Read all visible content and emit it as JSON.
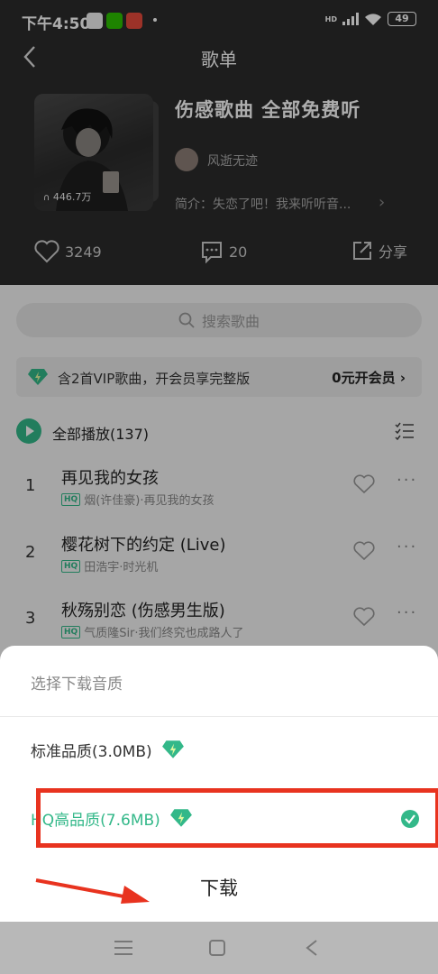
{
  "status_bar": {
    "time": "下午4:50",
    "network_label": "HD",
    "battery": "49"
  },
  "nav": {
    "title": "歌单"
  },
  "playlist": {
    "title": "伤感歌曲  全部免费听",
    "play_count": "446.7万",
    "creator": "风逝无迹",
    "intro": "简介：失恋了吧！我来听听音..."
  },
  "actions": {
    "likes": "3249",
    "comments": "20",
    "share_label": "分享"
  },
  "search": {
    "placeholder": "搜索歌曲"
  },
  "vip_banner": {
    "text": "含2首VIP歌曲，开会员享完整版",
    "cta": "0元开会员"
  },
  "play_all": {
    "label": "全部播放(137)"
  },
  "songs": [
    {
      "index": "1",
      "title": "再见我的女孩",
      "badge": "HQ",
      "meta": "烟(许佳豪)·再见我的女孩"
    },
    {
      "index": "2",
      "title": "樱花树下的约定 (Live)",
      "badge": "HQ",
      "meta": "田浩宇·时光机"
    },
    {
      "index": "3",
      "title": "秋殇别恋 (伤感男生版)",
      "badge": "HQ",
      "meta": "气质隆Sir·我们终究也成路人了"
    }
  ],
  "sheet": {
    "title": "选择下载音质",
    "standard_quality": "标准品质(3.0MB)",
    "hq_quality": "HQ高品质(7.6MB)",
    "download_label": "下载"
  },
  "colors": {
    "accent": "#33b889",
    "highlight": "#e8331f",
    "header_bg": "#2c2c2c"
  }
}
